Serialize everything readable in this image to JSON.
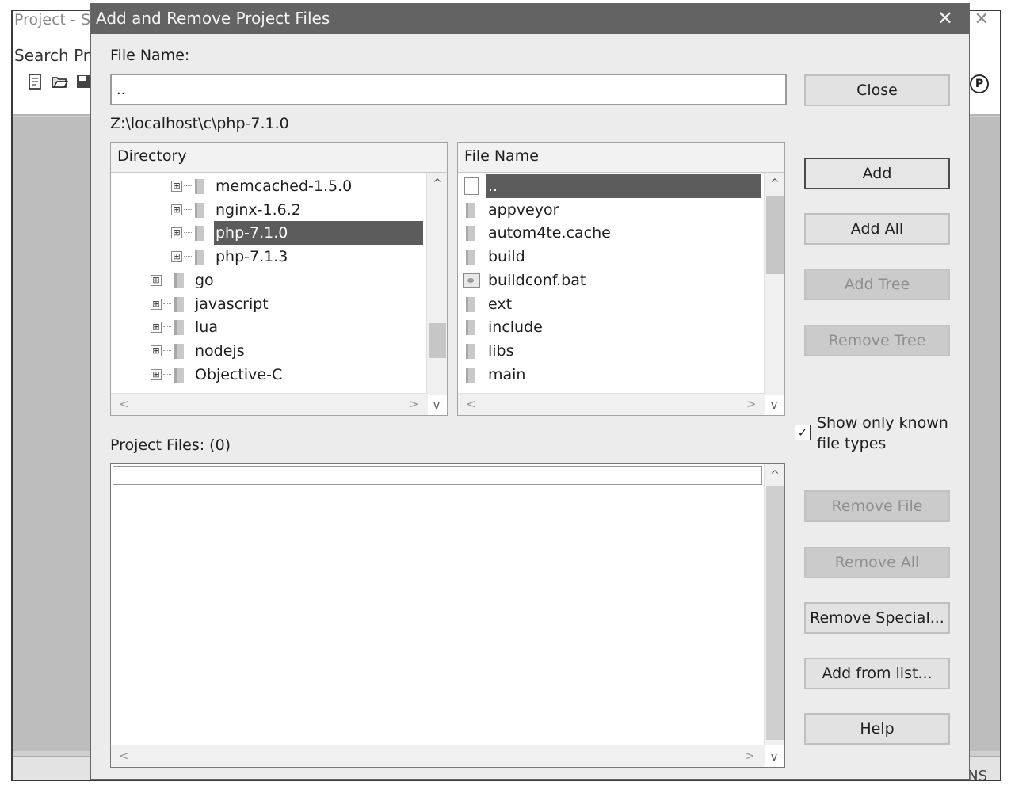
{
  "background": {
    "title": "Project - S",
    "menu": "Search  Pro",
    "close_glyph": "✕",
    "toolbar_icons": [
      "new-file-icon",
      "open-folder-icon",
      "save-icon"
    ],
    "p_badge": "P",
    "status_text": "NS"
  },
  "dialog": {
    "title": "Add and Remove Project Files",
    "close_glyph": "✕",
    "file_name_label": "File Name:",
    "file_name_value": "..",
    "path": "Z:\\localhost\\c\\php-7.1.0",
    "directory": {
      "header": "Directory",
      "items": [
        {
          "label": "memcached-1.5.0",
          "expander": "⊞"
        },
        {
          "label": "nginx-1.6.2",
          "expander": "⊞"
        },
        {
          "label": "php-7.1.0",
          "expander": "⊞",
          "selected": true
        },
        {
          "label": "php-7.1.3",
          "expander": "⊞"
        },
        {
          "label": "go",
          "expander": "⊞"
        },
        {
          "label": "javascript",
          "expander": "⊞"
        },
        {
          "label": "lua",
          "expander": "⊞"
        },
        {
          "label": "nodejs",
          "expander": "⊞"
        },
        {
          "label": "Objective-C",
          "expander": "⊞"
        }
      ]
    },
    "files": {
      "header": "File Name",
      "items": [
        {
          "label": "..",
          "type": "file",
          "selected": true
        },
        {
          "label": "appveyor",
          "type": "folder"
        },
        {
          "label": "autom4te.cache",
          "type": "folder"
        },
        {
          "label": "build",
          "type": "folder"
        },
        {
          "label": "buildconf.bat",
          "type": "bat"
        },
        {
          "label": "ext",
          "type": "folder"
        },
        {
          "label": "include",
          "type": "folder"
        },
        {
          "label": "libs",
          "type": "folder"
        },
        {
          "label": "main",
          "type": "folder"
        }
      ]
    },
    "project_files_label": "Project Files: (0)",
    "show_known": {
      "line1": "Show only known",
      "line2": "file types",
      "checked": "✓"
    },
    "scroll_glyphs": {
      "up": "^",
      "down": "v",
      "left": "<",
      "right": ">"
    },
    "buttons": {
      "close": "Close",
      "add": "Add",
      "add_all": "Add All",
      "add_tree": "Add Tree",
      "remove_tree": "Remove Tree",
      "remove_file": "Remove File",
      "remove_all": "Remove All",
      "remove_special": "Remove Special...",
      "add_from_list": "Add from list...",
      "help": "Help"
    }
  }
}
